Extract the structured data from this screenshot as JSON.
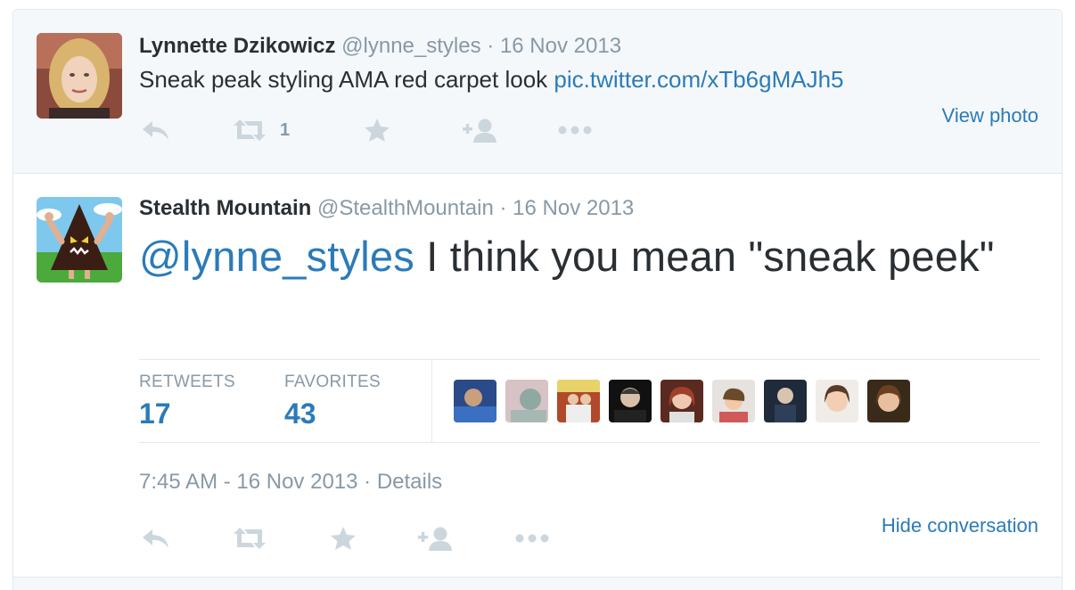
{
  "tweet1": {
    "avatar": "avatar-lynne",
    "fullname": "Lynnette Dzikowicz",
    "handle": "@lynne_styles",
    "separator": "·",
    "date": "16 Nov 2013",
    "text": "Sneak peak styling AMA red carpet look",
    "link": "pic.twitter.com/xTb6gMAJh5",
    "retweet_count": "1",
    "view_photo": "View photo",
    "icons": [
      "reply-icon",
      "retweet-icon",
      "favorite-icon",
      "follow-icon",
      "more-icon"
    ]
  },
  "tweet2": {
    "avatar": "avatar-stealth-mountain",
    "fullname": "Stealth Mountain",
    "handle": "@StealthMountain",
    "separator": "·",
    "date": "16 Nov 2013",
    "mention": "@lynne_styles",
    "text": " I think you mean \"sneak peek\"",
    "stats": {
      "retweets_label": "RETWEETS",
      "retweets_value": "17",
      "favorites_label": "FAVORITES",
      "favorites_value": "43"
    },
    "favoriter_avatars": [
      "favoriter-1",
      "favoriter-2",
      "favoriter-3",
      "favoriter-4",
      "favoriter-5",
      "favoriter-6",
      "favoriter-7",
      "favoriter-8",
      "favoriter-9"
    ],
    "timestamp": "7:45 AM - 16 Nov 2013",
    "timestamp_separator": " · ",
    "details": "Details",
    "hide_conversation": "Hide conversation",
    "icons": [
      "reply-icon",
      "retweet-icon",
      "favorite-icon",
      "follow-icon",
      "more-icon"
    ]
  },
  "colors": {
    "link": "#2b7bb9",
    "text": "#292f33",
    "muted": "#8899a6",
    "icon": "#ccd6dd",
    "border": "#e1e8ed",
    "highlight_bg": "#f5f8fa"
  }
}
